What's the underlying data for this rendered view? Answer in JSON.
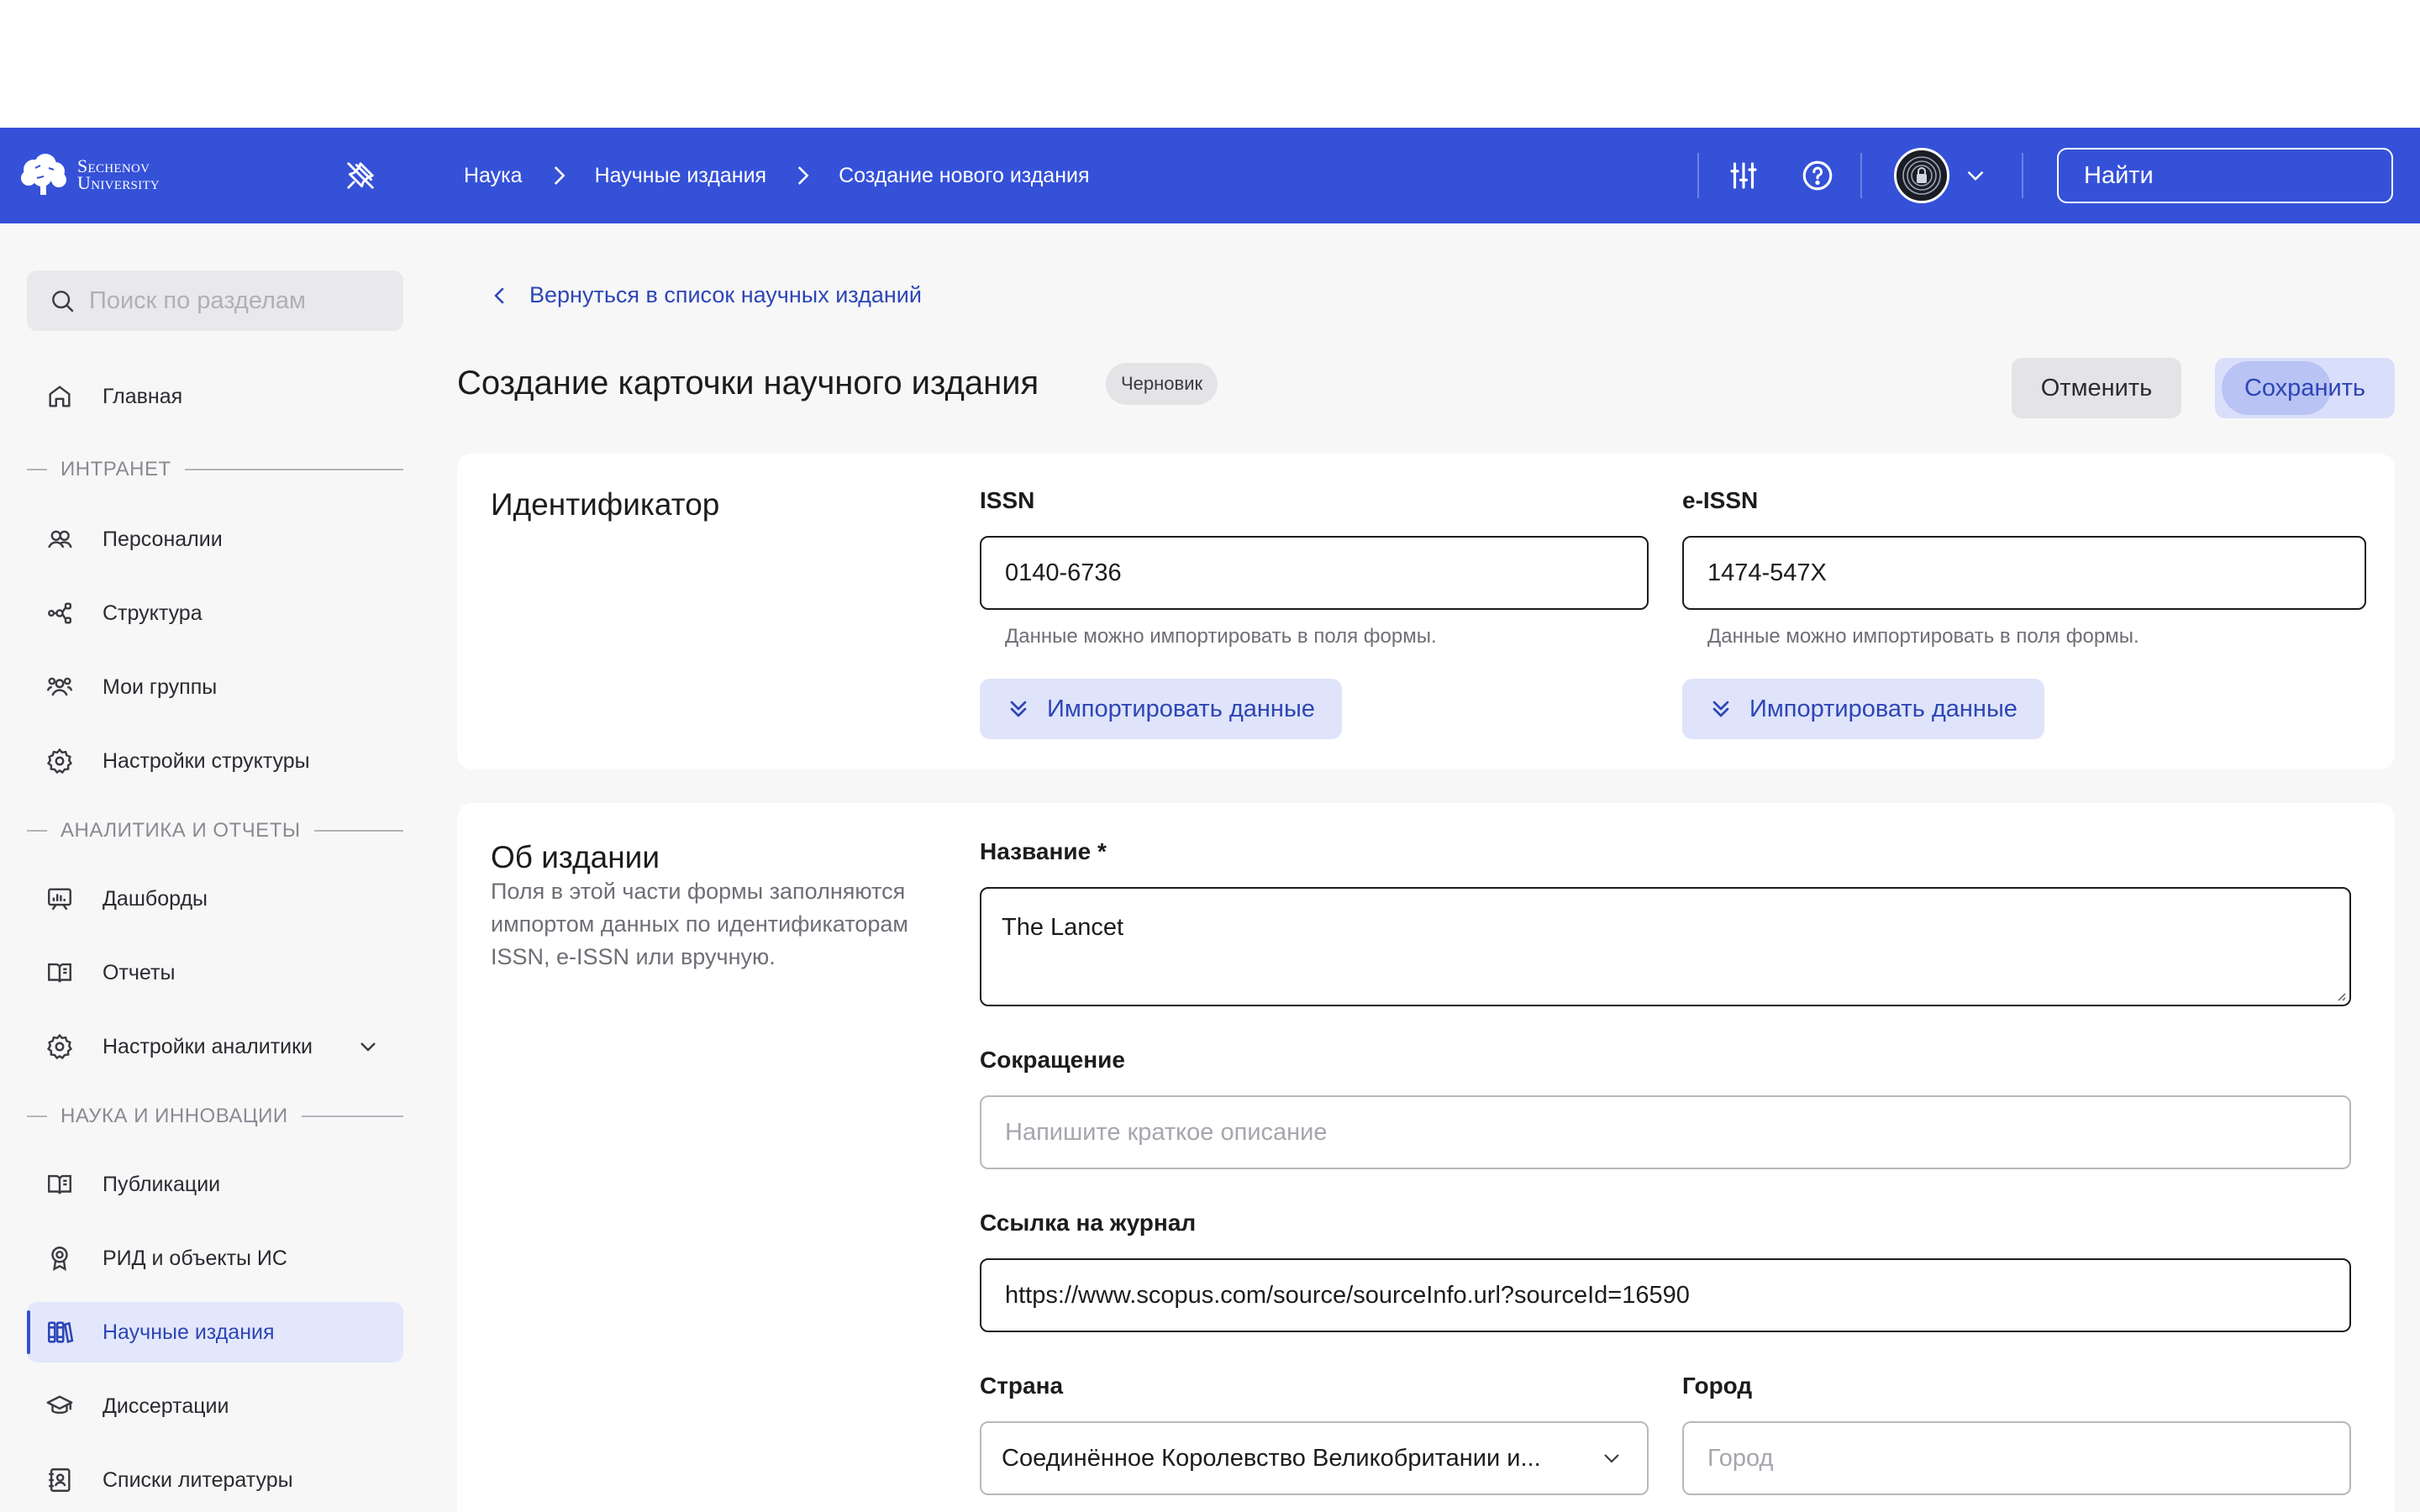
{
  "header": {
    "logo_line1": "Sechenov",
    "logo_line2": "University",
    "breadcrumbs": [
      "Наука",
      "Научные издания",
      "Создание нового издания"
    ],
    "search_placeholder": "Найти"
  },
  "sidebar": {
    "search_placeholder": "Поиск по разделам",
    "home": "Главная",
    "sections": {
      "intranet": "ИНТРАНЕТ",
      "analytics": "АНАЛИТИКА И ОТЧЕТЫ",
      "science": "НАУКА И ИННОВАЦИИ"
    },
    "items": {
      "personnel": "Персоналии",
      "structure": "Структура",
      "groups": "Мои группы",
      "structure_settings": "Настройки структуры",
      "dashboards": "Дашборды",
      "reports": "Отчеты",
      "analytics_settings": "Настройки аналитики",
      "publications": "Публикации",
      "rid": "РИД и объекты ИС",
      "journals": "Научные издания",
      "dissertations": "Диссертации",
      "literature": "Списки литературы"
    },
    "active_item": "journals"
  },
  "main": {
    "back_link": "Вернуться в список научных изданий",
    "title": "Создание карточки научного издания",
    "status_badge": "Черновик",
    "cancel_label": "Отменить",
    "save_label": "Сохранить"
  },
  "identifier": {
    "title": "Идентификатор",
    "issn_label": "ISSN",
    "issn_value": "0140-6736",
    "eissn_label": "e-ISSN",
    "eissn_value": "1474-547X",
    "hint": "Данные можно импортировать в поля формы.",
    "import_label": "Импортировать данные"
  },
  "about": {
    "title": "Об издании",
    "description": "Поля в этой части формы заполняются импортом данных по идентификаторам ISSN, e-ISSN или вручную.",
    "name_label": "Название *",
    "name_value": "The Lancet",
    "abbr_label": "Сокращение",
    "abbr_placeholder": "Напишите краткое описание",
    "link_label": "Ссылка на журнал",
    "link_value": "https://www.scopus.com/source/sourceInfo.url?sourceId=16590",
    "country_label": "Страна",
    "country_value": "Соединённое Королевство Великобритании и...",
    "city_label": "Город",
    "city_placeholder": "Город"
  },
  "colors": {
    "header_bg": "#3551d8",
    "accent": "#2d46b5",
    "active_bg": "#e3e7fb",
    "page_bg": "#f7f7f8"
  }
}
